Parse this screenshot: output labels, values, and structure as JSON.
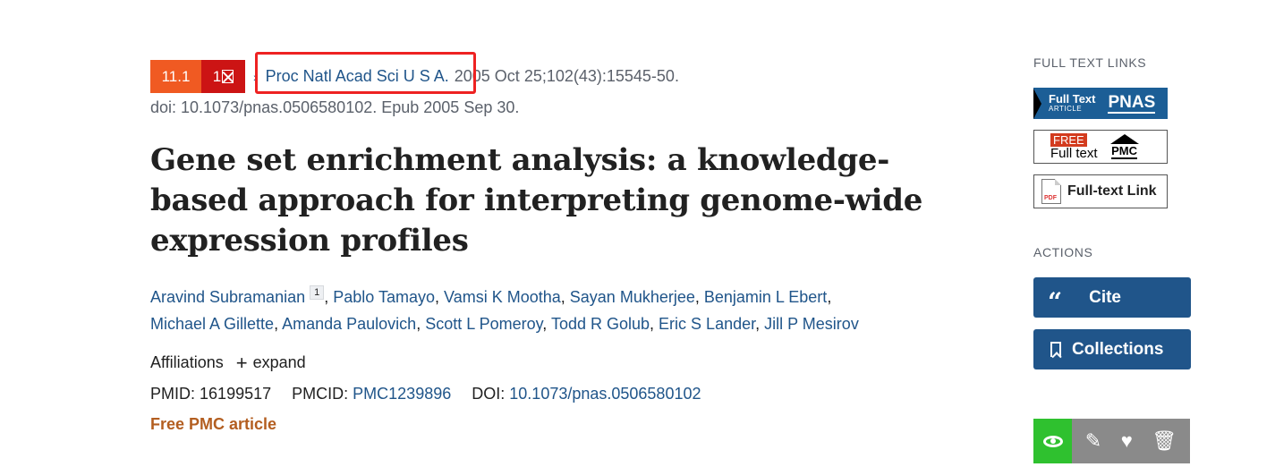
{
  "citation": {
    "impact_factor": "11.1",
    "quartile": "1",
    "journal": "Proc Natl Acad Sci U S A.",
    "date_volume": "2005 Oct 25;102(43):15545-50.",
    "doi_epub": "doi: 10.1073/pnas.0506580102. Epub 2005 Sep 30."
  },
  "article": {
    "title": "Gene set enrichment analysis: a knowledge-based approach for interpreting genome-wide expression profiles"
  },
  "authors": [
    "Aravind Subramanian",
    "Pablo Tamayo",
    "Vamsi K Mootha",
    "Sayan Mukherjee",
    "Benjamin L Ebert",
    "Michael A Gillette",
    "Amanda Paulovich",
    "Scott L Pomeroy",
    "Todd R Golub",
    "Eric S Lander",
    "Jill P Mesirov"
  ],
  "first_author_affiliation_ref": "1",
  "affiliations": {
    "label": "Affiliations",
    "expand": "expand"
  },
  "ids": {
    "pmid_label": "PMID:",
    "pmid": "16199517",
    "pmcid_label": "PMCID:",
    "pmcid": "PMC1239896",
    "doi_label": "DOI:",
    "doi": "10.1073/pnas.0506580102"
  },
  "free_pmc": "Free PMC article",
  "sidebar": {
    "full_text_heading": "FULL TEXT LINKS",
    "pnas": {
      "line1": "Full Text",
      "line2": "ARTICLE",
      "brand": "PNAS"
    },
    "pmc": {
      "free": "FREE",
      "full_text": "Full text",
      "brand": "PMC"
    },
    "pdf_badge": "PDF",
    "full_text_link": "Full-text Link",
    "actions_heading": "ACTIONS",
    "cite_label": "Cite",
    "collections_label": "Collections"
  },
  "toolbar_icons": [
    "eye-icon",
    "pin-icon",
    "heart-icon",
    "trash-icon"
  ],
  "colors": {
    "link": "#20558a",
    "impact_badge": "#f05a22",
    "quartile_badge": "#cc1414",
    "highlight_box": "#ee2222",
    "free_pmc": "#b35e20",
    "action_button": "#20558a",
    "toolbar_active": "#2fc12f",
    "toolbar_grey": "#8a8a8a"
  }
}
